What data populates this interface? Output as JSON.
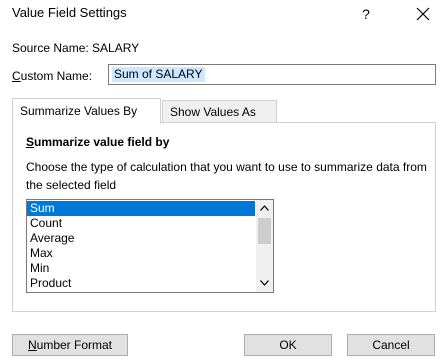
{
  "window": {
    "title": "Value Field Settings",
    "help_label": "?"
  },
  "source": {
    "label": "Source Name:",
    "value": "SALARY"
  },
  "custom_name": {
    "label_accel": "C",
    "label_rest": "ustom Name:",
    "value": "Sum of SALARY"
  },
  "tabs": [
    {
      "label": "Summarize Values By",
      "active": true
    },
    {
      "label": "Show Values As",
      "active": false
    }
  ],
  "summarize": {
    "group_title_accel": "S",
    "group_title_rest": "ummarize value field by",
    "description": "Choose the type of calculation that you want to use to summarize data from the selected field",
    "items": [
      "Sum",
      "Count",
      "Average",
      "Max",
      "Min",
      "Product"
    ],
    "selected": "Sum"
  },
  "buttons": {
    "number_format_accel": "N",
    "number_format_rest": "umber Format",
    "ok": "OK",
    "cancel": "Cancel"
  },
  "colors": {
    "selection": "#0078d7",
    "text_highlight": "#cce8ff"
  }
}
